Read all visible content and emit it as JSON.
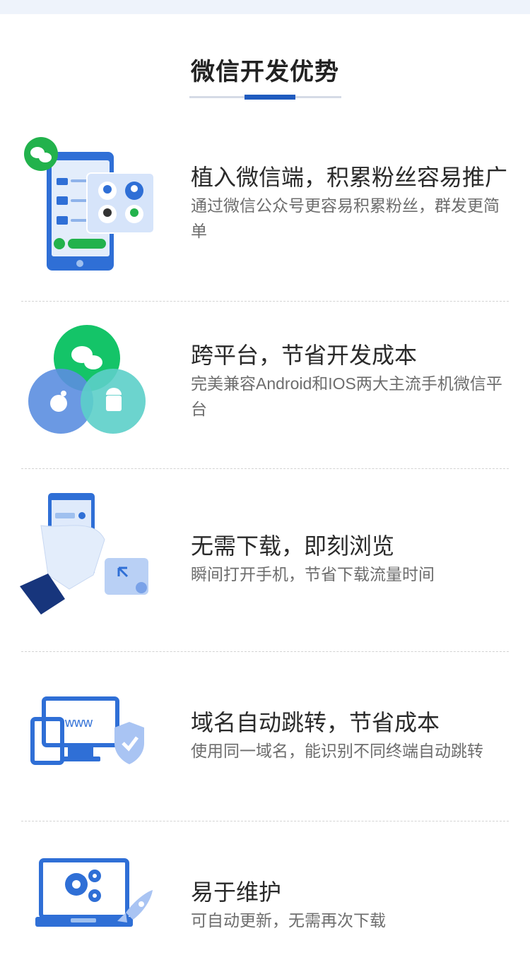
{
  "section": {
    "title": "微信开发优势"
  },
  "colors": {
    "accent": "#1f5bbf",
    "wechat_green": "#07c160",
    "apple_blue": "#5b8ee0",
    "android_teal": "#5ccfc9"
  },
  "features": [
    {
      "icon": "phone-contacts-icon",
      "title": "植入微信端，积累粉丝容易推广",
      "desc": "通过微信公众号更容易积累粉丝，群发更简单"
    },
    {
      "icon": "cross-platform-icon",
      "title": "跨平台，节省开发成本",
      "desc": "完美兼容Android和IOS两大主流手机微信平台"
    },
    {
      "icon": "hand-phone-icon",
      "title": "无需下载，即刻浏览",
      "desc": "瞬间打开手机，节省下载流量时间"
    },
    {
      "icon": "domain-redirect-icon",
      "title": "域名自动跳转，节省成本",
      "desc": "使用同一域名，能识别不同终端自动跳转"
    },
    {
      "icon": "maintenance-icon",
      "title": "易于维护",
      "desc": "可自动更新，无需再次下载"
    }
  ],
  "illustration_text": {
    "www": "www"
  }
}
